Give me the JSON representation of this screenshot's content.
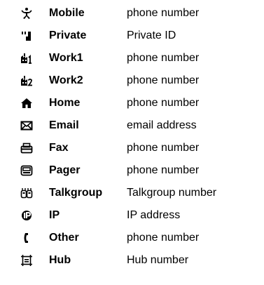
{
  "entries": [
    {
      "icon": "mobile-icon",
      "type": "Mobile",
      "description": "phone number"
    },
    {
      "icon": "private-icon",
      "type": "Private",
      "description": "Private ID"
    },
    {
      "icon": "work1-icon",
      "type": "Work1",
      "description": "phone number"
    },
    {
      "icon": "work2-icon",
      "type": "Work2",
      "description": "phone number"
    },
    {
      "icon": "home-icon",
      "type": "Home",
      "description": "phone number"
    },
    {
      "icon": "email-icon",
      "type": "Email",
      "description": "email address"
    },
    {
      "icon": "fax-icon",
      "type": "Fax",
      "description": "phone number"
    },
    {
      "icon": "pager-icon",
      "type": "Pager",
      "description": "phone number"
    },
    {
      "icon": "talkgroup-icon",
      "type": "Talkgroup",
      "description": "Talkgroup number"
    },
    {
      "icon": "ip-icon",
      "type": "IP",
      "description": "IP address"
    },
    {
      "icon": "other-icon",
      "type": "Other",
      "description": "phone number"
    },
    {
      "icon": "hub-icon",
      "type": "Hub",
      "description": "Hub number"
    }
  ]
}
